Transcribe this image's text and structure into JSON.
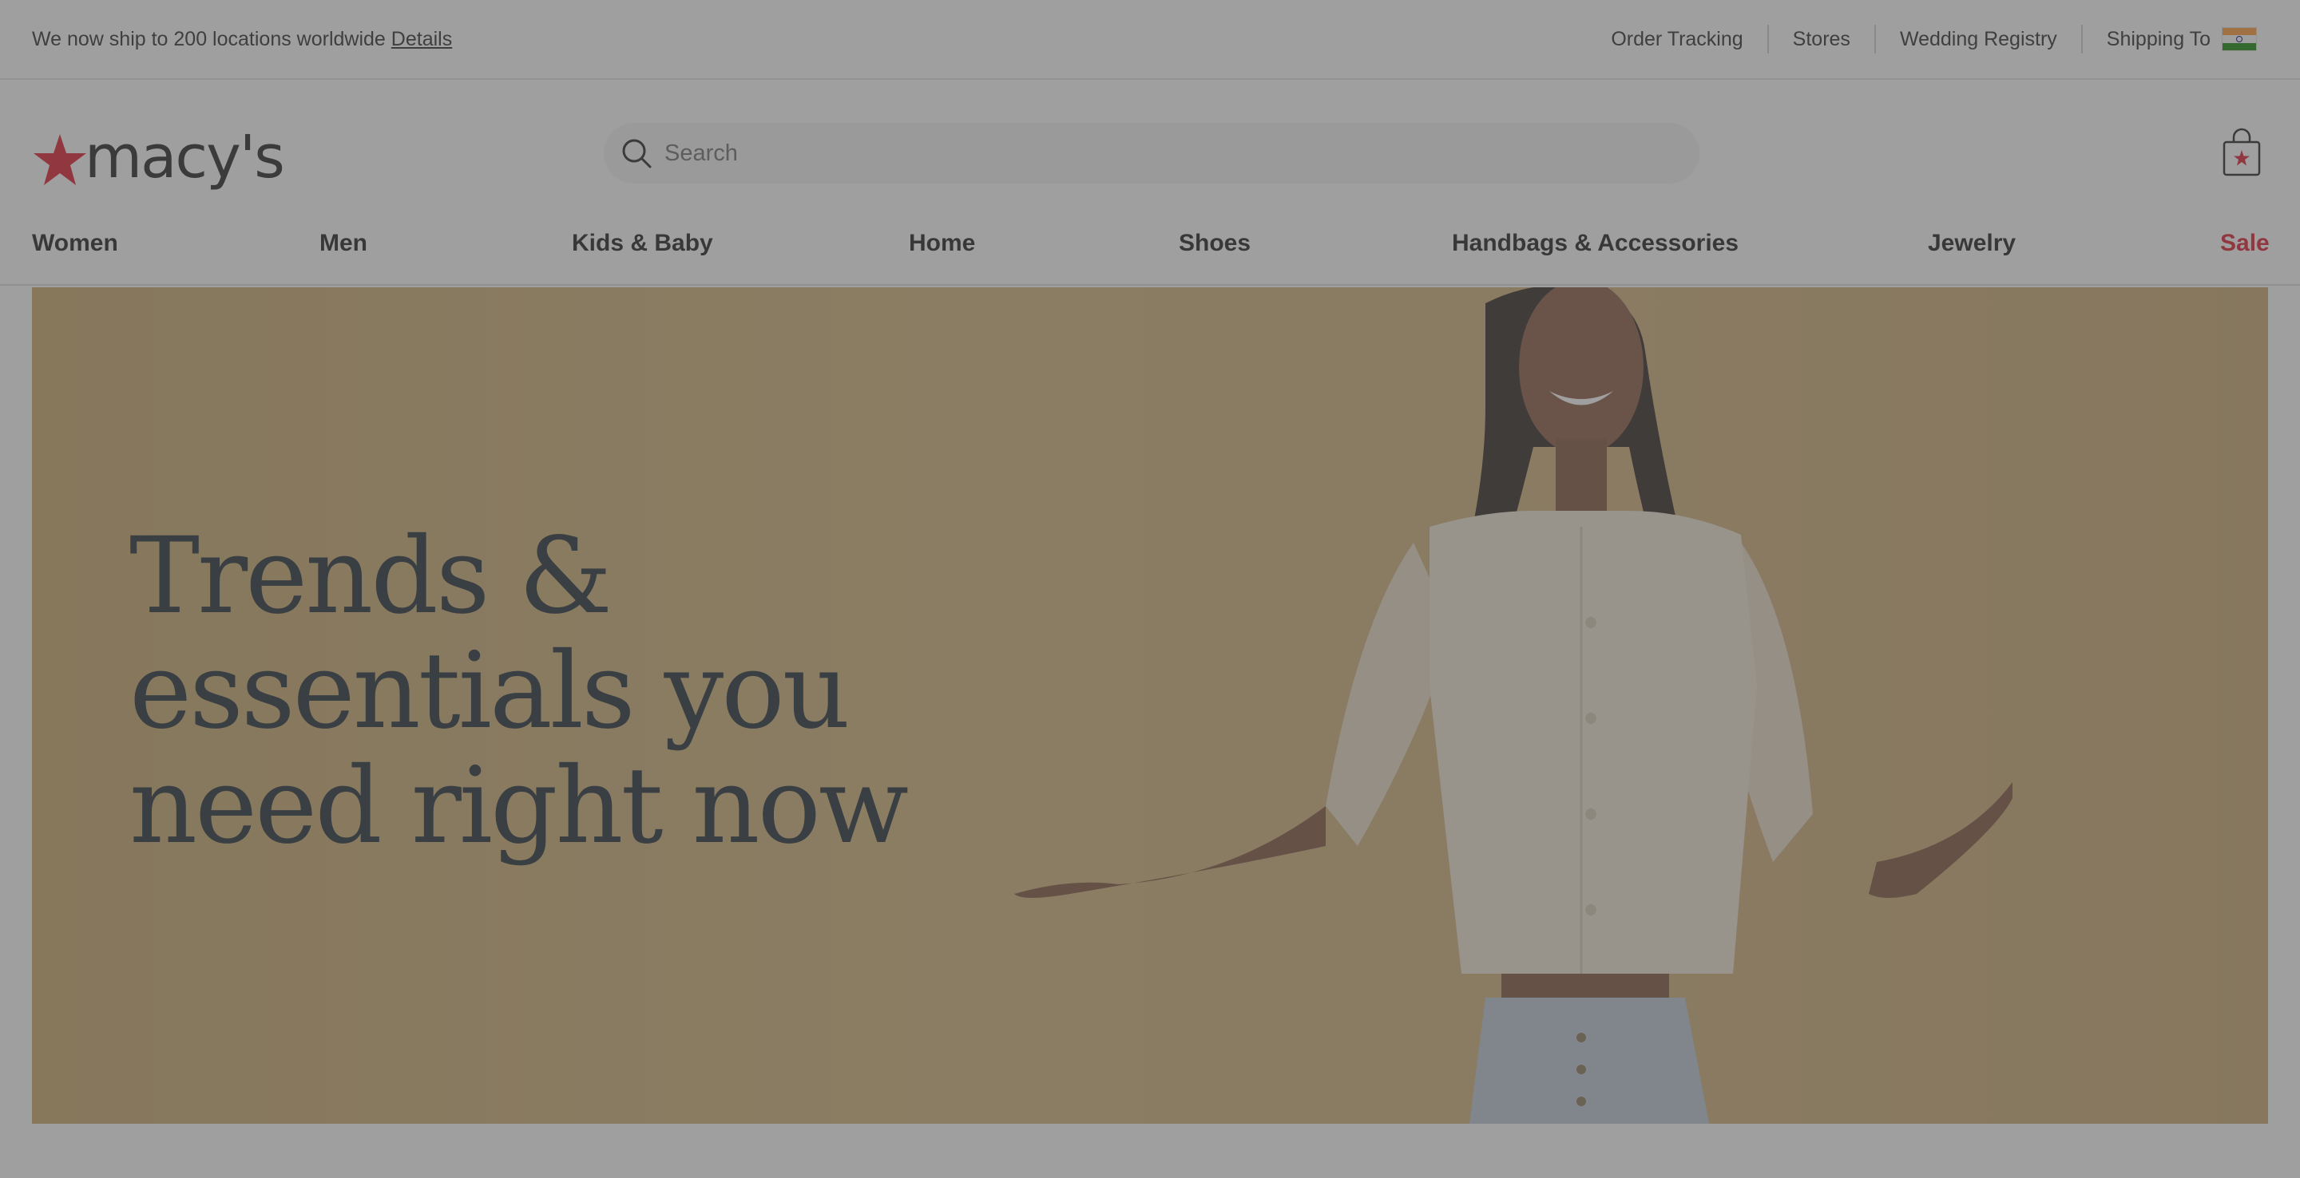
{
  "utility": {
    "ship_message": "We now ship to 200 locations worldwide",
    "details_link": "Details",
    "links": [
      "Order Tracking",
      "Stores",
      "Wedding Registry"
    ],
    "shipping_to": "Shipping To"
  },
  "header": {
    "logo_text": "macy's",
    "search_placeholder": "Search"
  },
  "nav": {
    "items": [
      "Women",
      "Men",
      "Kids & Baby",
      "Home",
      "Shoes",
      "Handbags & Accessories",
      "Jewelry",
      "Sale"
    ]
  },
  "hero": {
    "line1": "Trends &",
    "line2": "essentials you",
    "line3": "need right now"
  },
  "colors": {
    "brand_red": "#e11a2b",
    "hero_background": "#d0b079",
    "overlay": "#505050"
  },
  "icons": [
    "search-icon",
    "shopping-bag-icon",
    "macys-star-icon",
    "india-flag-icon"
  ]
}
